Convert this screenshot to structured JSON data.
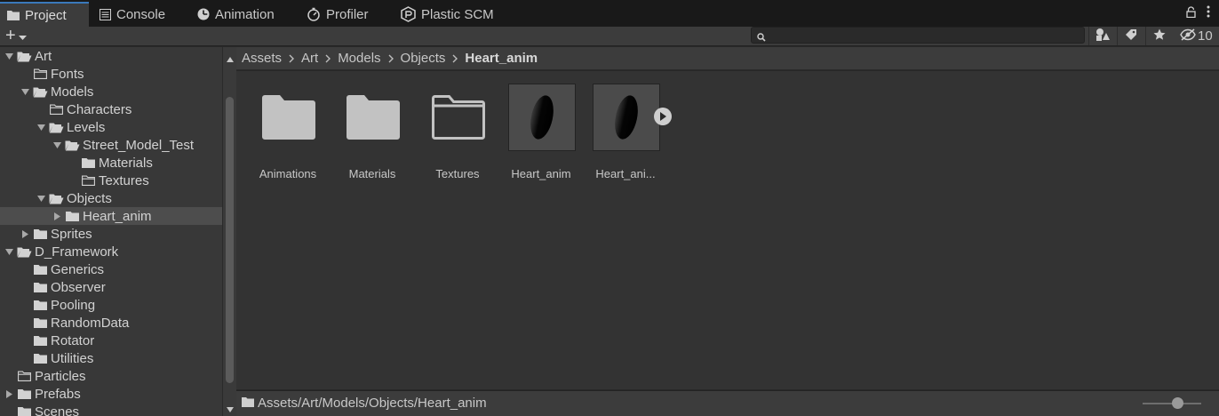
{
  "tabs": [
    {
      "label": "Project",
      "icon": "folder-icon",
      "active": true
    },
    {
      "label": "Console",
      "icon": "console-icon"
    },
    {
      "label": "Animation",
      "icon": "animation-icon"
    },
    {
      "label": "Profiler",
      "icon": "profiler-icon"
    },
    {
      "label": "Plastic SCM",
      "icon": "plastic-scm-icon"
    }
  ],
  "toolbar": {
    "add_label": "+",
    "search_value": "",
    "hidden_count": "10"
  },
  "tree": [
    {
      "label": "Art",
      "depth": 0,
      "expanded": true,
      "arrow": "down",
      "folder": "open"
    },
    {
      "label": "Fonts",
      "depth": 1,
      "arrow": "none",
      "folder": "empty"
    },
    {
      "label": "Models",
      "depth": 1,
      "arrow": "down",
      "folder": "open"
    },
    {
      "label": "Characters",
      "depth": 2,
      "arrow": "none",
      "folder": "empty"
    },
    {
      "label": "Levels",
      "depth": 2,
      "arrow": "down",
      "folder": "open"
    },
    {
      "label": "Street_Model_Test",
      "depth": 3,
      "arrow": "down",
      "folder": "open"
    },
    {
      "label": "Materials",
      "depth": 4,
      "arrow": "none",
      "folder": "filled"
    },
    {
      "label": "Textures",
      "depth": 4,
      "arrow": "none",
      "folder": "empty"
    },
    {
      "label": "Objects",
      "depth": 2,
      "arrow": "down",
      "folder": "open"
    },
    {
      "label": "Heart_anim",
      "depth": 3,
      "arrow": "right",
      "folder": "filled",
      "selected": true
    },
    {
      "label": "Sprites",
      "depth": 1,
      "arrow": "right",
      "folder": "filled"
    },
    {
      "label": "D_Framework",
      "depth": 0,
      "arrow": "down",
      "folder": "open"
    },
    {
      "label": "Generics",
      "depth": 1,
      "arrow": "none",
      "folder": "filled"
    },
    {
      "label": "Observer",
      "depth": 1,
      "arrow": "none",
      "folder": "filled"
    },
    {
      "label": "Pooling",
      "depth": 1,
      "arrow": "none",
      "folder": "filled"
    },
    {
      "label": "RandomData",
      "depth": 1,
      "arrow": "none",
      "folder": "filled"
    },
    {
      "label": "Rotator",
      "depth": 1,
      "arrow": "none",
      "folder": "filled"
    },
    {
      "label": "Utilities",
      "depth": 1,
      "arrow": "none",
      "folder": "filled"
    },
    {
      "label": "Particles",
      "depth": 0,
      "arrow": "none",
      "folder": "empty"
    },
    {
      "label": "Prefabs",
      "depth": 0,
      "arrow": "right",
      "folder": "filled"
    },
    {
      "label": "Scenes",
      "depth": 0,
      "arrow": "none",
      "folder": "filled"
    }
  ],
  "breadcrumb": [
    "Assets",
    "Art",
    "Models",
    "Objects",
    "Heart_anim"
  ],
  "assets": [
    {
      "label": "Animations",
      "kind": "folder-filled"
    },
    {
      "label": "Materials",
      "kind": "folder-filled"
    },
    {
      "label": "Textures",
      "kind": "folder-empty"
    },
    {
      "label": "Heart_anim",
      "kind": "model"
    },
    {
      "label": "Heart_ani...",
      "kind": "model"
    }
  ],
  "footer": {
    "path": "Assets/Art/Models/Objects/Heart_anim"
  }
}
